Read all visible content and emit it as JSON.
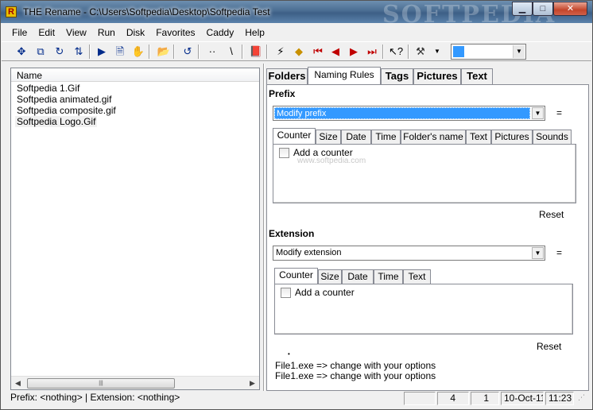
{
  "window": {
    "app_letter": "R",
    "title": "THE Rename - C:\\Users\\Softpedia\\Desktop\\Softpedia Test",
    "watermark": "SOFTPEDIA",
    "minimize_glyph": "▁",
    "maximize_glyph": "□",
    "close_glyph": "✕"
  },
  "menu": [
    "File",
    "Edit",
    "View",
    "Run",
    "Disk",
    "Favorites",
    "Caddy",
    "Help"
  ],
  "toolbar": {
    "icons": [
      "move-icon",
      "copy-icon",
      "refresh-icon",
      "toggle-icon",
      "play-icon",
      "preview-icon",
      "hand-icon",
      "open-folder-icon",
      "undo-icon",
      "dots-icon",
      "backslash-icon",
      "book-icon",
      "wand-icon",
      "eraser-icon",
      "first-icon",
      "prev-icon",
      "next-icon",
      "last-icon",
      "help-pointer-icon",
      "tools-icon"
    ],
    "combo_arrow": "▼"
  },
  "filelist": {
    "column": "Name",
    "files": [
      "Softpedia 1.Gif",
      "Softpedia animated.gif",
      "Softpedia composite.gif",
      "Softpedia Logo.Gif"
    ],
    "scroll_left": "◀",
    "scroll_right": "▶",
    "thumb_grip": "|||"
  },
  "tabs": [
    "Folders",
    "Naming Rules",
    "Tags",
    "Pictures",
    "Text"
  ],
  "active_tab": "Naming Rules",
  "prefix": {
    "title": "Prefix",
    "combo_value": "Modify prefix",
    "combo_arrow": "▼",
    "equals": "=",
    "subtabs": [
      "Counter",
      "Size",
      "Date",
      "Time",
      "Folder's name",
      "Text",
      "Pictures",
      "Sounds"
    ],
    "checkbox_label": "Add a counter",
    "ghost_text": "www.softpedia.com",
    "reset": "Reset"
  },
  "extension": {
    "title": "Extension",
    "combo_value": "Modify extension",
    "combo_arrow": "▼",
    "equals": "=",
    "subtabs": [
      "Counter",
      "Size",
      "Date",
      "Time",
      "Text"
    ],
    "checkbox_label": "Add a counter",
    "reset": "Reset"
  },
  "preview": {
    "dot": "•",
    "line1": "File1.exe => change with your options",
    "line2": "File1.exe => change with your options"
  },
  "status": {
    "left": "Prefix: <nothing> | Extension: <nothing>",
    "count": "4",
    "selected": "1",
    "date": "10-Oct-11",
    "time": "11:23"
  },
  "colors": {
    "selection": "#3399ff",
    "toolbar_icon": "#002a8a",
    "toolbar_icon_red": "#c00000"
  }
}
